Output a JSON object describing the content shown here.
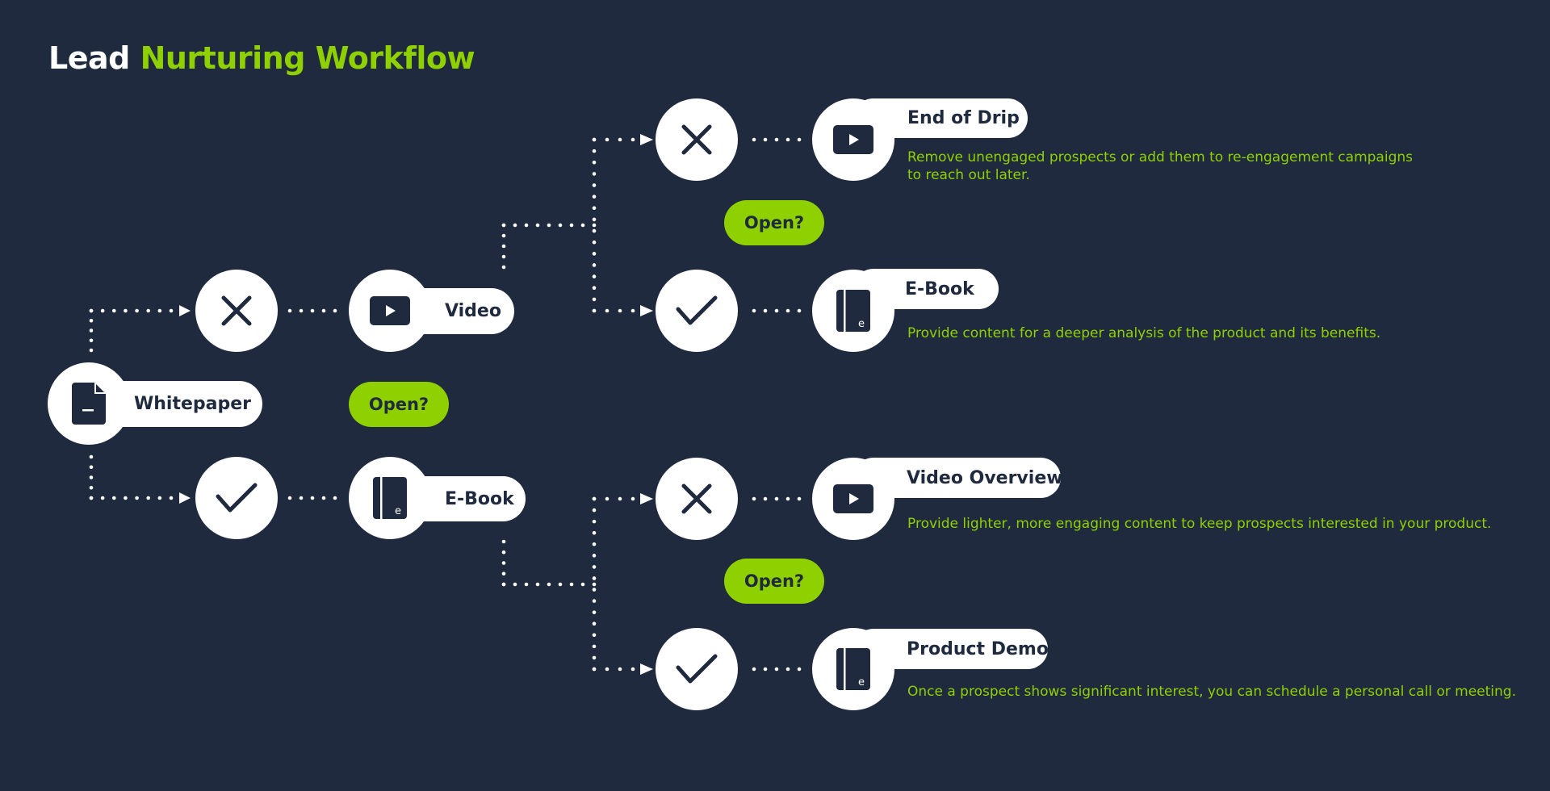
{
  "title": {
    "part1": "Lead",
    "part2": "Nurturing Workflow"
  },
  "colors": {
    "background": "#1f2a3f",
    "accent": "#8fd100",
    "node": "#ffffff",
    "icon": "#1f2a3f"
  },
  "start_node": {
    "label": "Whitepaper",
    "icon": "document-icon"
  },
  "decisions": {
    "first": "Open?",
    "video_branch": "Open?",
    "ebook_branch": "Open?"
  },
  "level1": {
    "no": {
      "icon": "x-icon",
      "next": {
        "label": "Video",
        "icon": "play-icon"
      }
    },
    "yes": {
      "icon": "check-icon",
      "next": {
        "label": "E-Book",
        "icon": "ebook-icon"
      }
    }
  },
  "level2": [
    {
      "outcome_icon": "x-icon",
      "label": "End of Drip",
      "icon": "play-icon",
      "description_lines": [
        "Remove unengaged prospects or add them to re-engagement campaigns",
        "to reach out later."
      ]
    },
    {
      "outcome_icon": "check-icon",
      "label": "E-Book",
      "icon": "ebook-icon",
      "description_lines": [
        "Provide content for a deeper analysis of the product and its benefits."
      ]
    },
    {
      "outcome_icon": "x-icon",
      "label": "Video Overview",
      "icon": "play-icon",
      "description_lines": [
        "Provide lighter, more engaging content to keep prospects interested in your product."
      ]
    },
    {
      "outcome_icon": "check-icon",
      "label": "Product Demo",
      "icon": "ebook-icon",
      "description_lines": [
        "Once a prospect shows significant interest, you can schedule a personal call or meeting."
      ]
    }
  ]
}
